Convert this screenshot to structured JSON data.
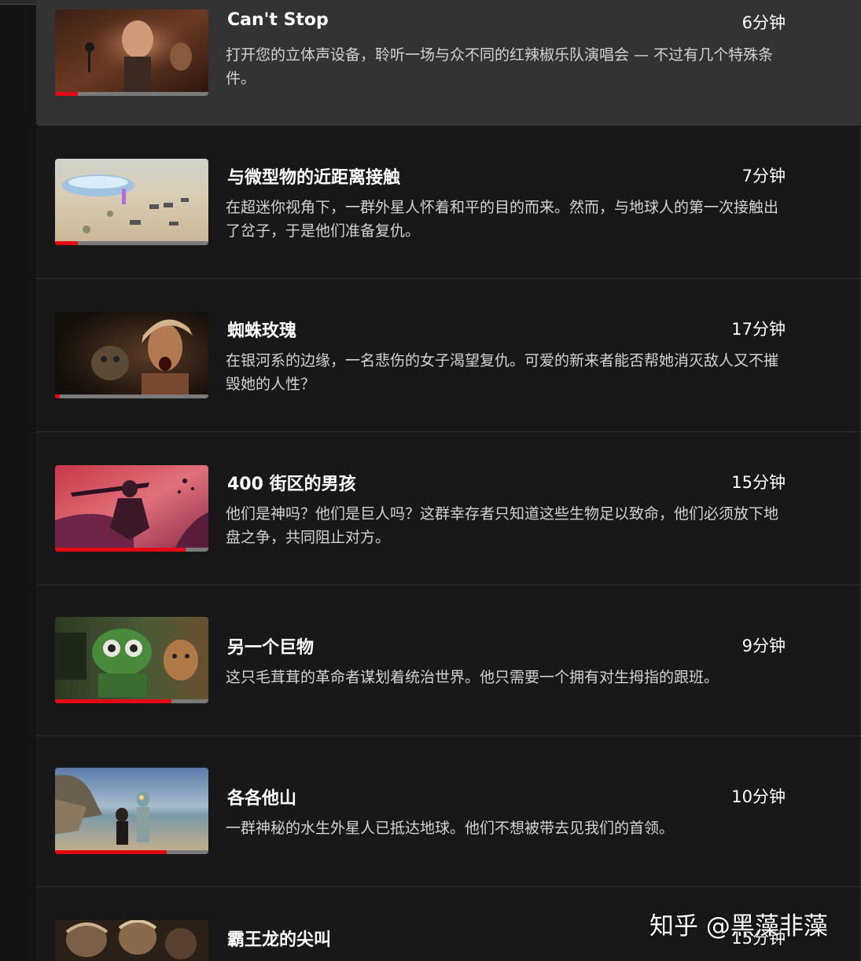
{
  "colors": {
    "background": "#181818",
    "active_row": "#333333",
    "progress_fill": "#e50914",
    "progress_track": "#7a7a7a"
  },
  "episodes": [
    {
      "title": "Can't Stop",
      "duration": "6分钟",
      "description": "打开您的立体声设备，聆听一场与众不同的红辣椒乐队演唱会 — 不过有几个特殊条件。",
      "progress": 0.15,
      "active": true
    },
    {
      "title": "与微型物的近距离接触",
      "duration": "7分钟",
      "description": "在超迷你视角下，一群外星人怀着和平的目的而来。然而，与地球人的第一次接触出了岔子，于是他们准备复仇。",
      "progress": 0.15,
      "active": false
    },
    {
      "title": "蜘蛛玫瑰",
      "duration": "17分钟",
      "description": "在银河系的边缘，一名悲伤的女子渴望复仇。可爱的新来者能否帮她消灭敌人又不摧毁她的人性？",
      "progress": 0.03,
      "active": false
    },
    {
      "title": "400 街区的男孩",
      "duration": "15分钟",
      "description": "他们是神吗？他们是巨人吗？这群幸存者只知道这些生物足以致命，他们必须放下地盘之争，共同阻止对方。",
      "progress": 0.85,
      "active": false
    },
    {
      "title": "另一个巨物",
      "duration": "9分钟",
      "description": "这只毛茸茸的革命者谋划着统治世界。他只需要一个拥有对生拇指的跟班。",
      "progress": 0.76,
      "active": false
    },
    {
      "title": "各各他山",
      "duration": "10分钟",
      "description": "一群神秘的水生外星人已抵达地球。他们不想被带去见我们的首领。",
      "progress": 0.73,
      "active": false
    },
    {
      "title": "霸王龙的尖叫",
      "duration": "15分钟",
      "description": "",
      "progress": 0,
      "active": false
    }
  ],
  "watermark": "知乎 @黑藻非藻"
}
